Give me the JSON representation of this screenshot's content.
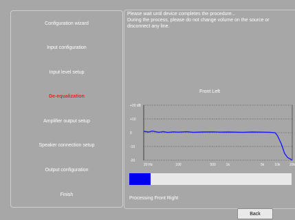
{
  "wizard": {
    "steps": [
      {
        "label": "Configuration wizard",
        "active": false
      },
      {
        "label": "Input configuration",
        "active": false
      },
      {
        "label": "Input level setup",
        "active": false
      },
      {
        "label": "De-equalization",
        "active": true
      },
      {
        "label": "Amplifier output setup",
        "active": false
      },
      {
        "label": "Speaker connection setup",
        "active": false
      },
      {
        "label": "Output configuration",
        "active": false
      },
      {
        "label": "Finish",
        "active": false
      }
    ]
  },
  "main": {
    "message_line1": "Please wait until device completes the procedure...",
    "message_line2": "During the process, please do not change volume on the source or",
    "message_line3": "disconnect any line.",
    "status": "Processing Front Right",
    "back_label": "Back"
  },
  "progress": {
    "fraction": 0.13
  },
  "colors": {
    "active_step": "#ff1a1a",
    "curve": "#1a1aff",
    "progress": "#0000ee"
  },
  "chart_data": {
    "type": "line",
    "title": "Front Left",
    "y_tick_labels": [
      "+20 dB",
      "+10",
      "0",
      "-10",
      "-20"
    ],
    "y_ticks": [
      20,
      10,
      0,
      -10,
      -20
    ],
    "x_tick_labels": [
      "20 Hz",
      "100",
      "500",
      "1k",
      "5k",
      "10k",
      "20k"
    ],
    "x_ticks": [
      20,
      100,
      500,
      1000,
      5000,
      10000,
      20000
    ],
    "xscale": "log",
    "xlim": [
      20,
      20000
    ],
    "ylim": [
      -20,
      20
    ],
    "grid": "dotted",
    "series": [
      {
        "x": [
          20,
          25,
          30,
          40,
          50,
          60,
          80,
          100,
          150,
          200,
          300,
          500,
          700,
          1000,
          2000,
          3000,
          5000,
          7000,
          9000,
          10000,
          12000,
          14000,
          16000,
          18000,
          20000
        ],
        "y": [
          1,
          0.5,
          1.2,
          0.3,
          0.8,
          0.2,
          0.6,
          0.4,
          0.7,
          0.3,
          0.5,
          0.6,
          0.4,
          0.5,
          0.3,
          0.5,
          0.4,
          0.3,
          0,
          -2,
          -8,
          -15,
          -18,
          -19,
          -20
        ]
      }
    ]
  }
}
